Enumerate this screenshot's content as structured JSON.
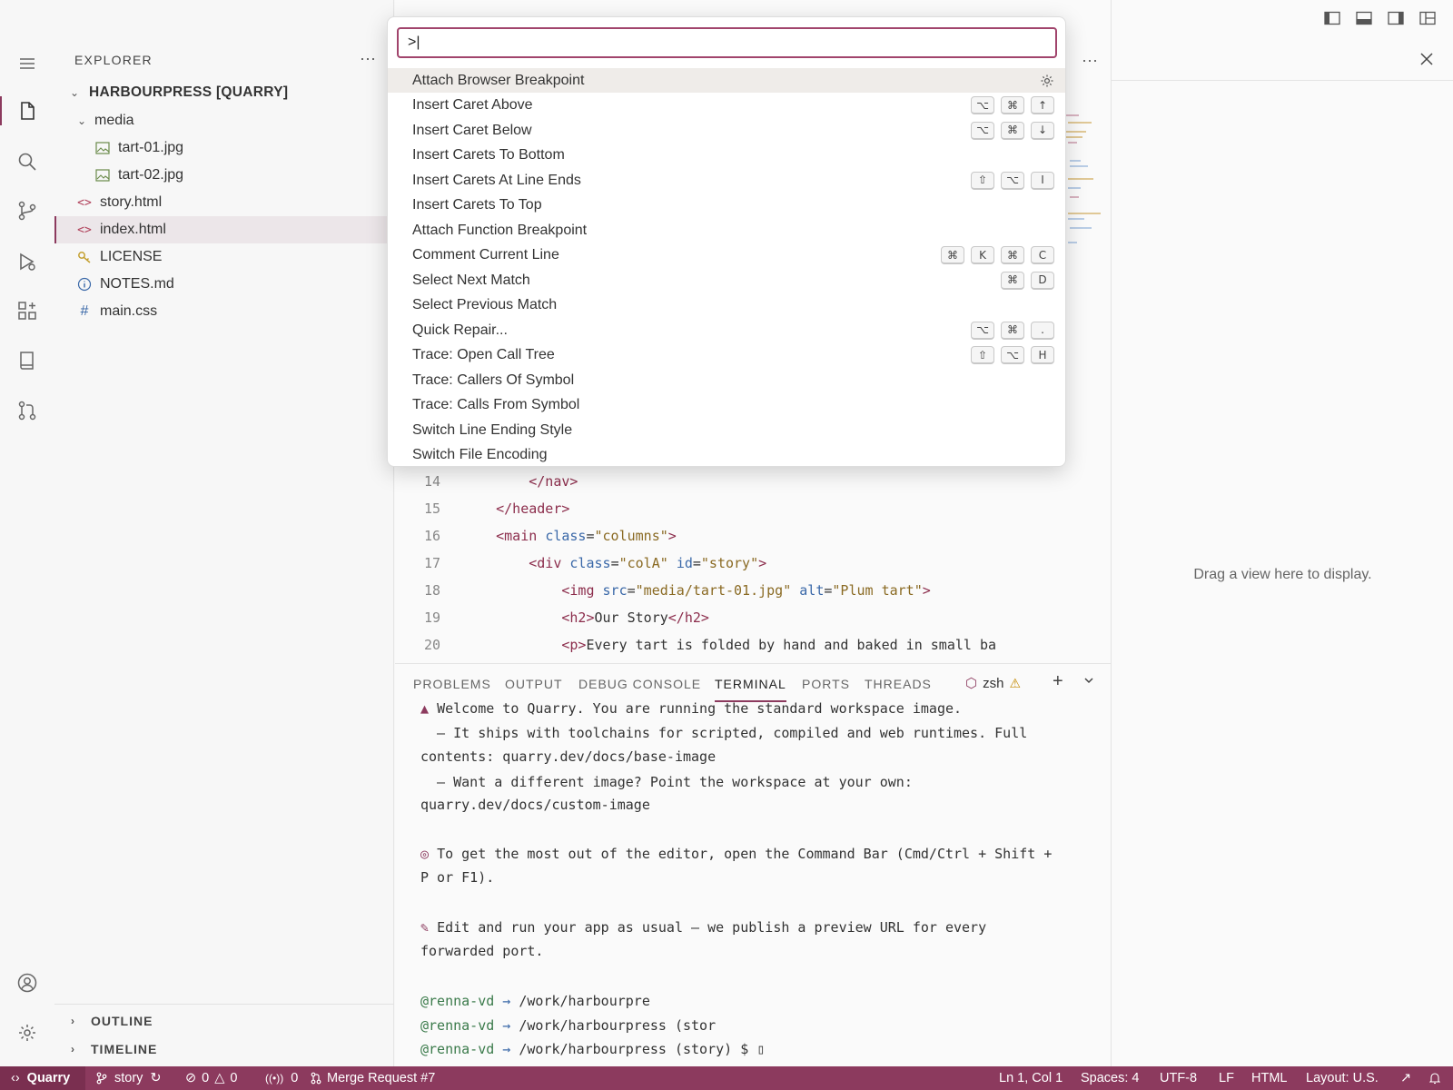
{
  "sidebar": {
    "title": "EXPLORER",
    "more": "···",
    "root": "HARBOURPRESS [QUARRY]",
    "items": [
      {
        "label": "media",
        "icon": "folder"
      },
      {
        "label": "tart-01.jpg",
        "icon": "image-icon"
      },
      {
        "label": "tart-02.jpg",
        "icon": "image-icon"
      },
      {
        "label": "story.html",
        "icon": "html-icon"
      },
      {
        "label": "index.html",
        "icon": "html-icon"
      },
      {
        "label": "LICENSE",
        "icon": "key-icon"
      },
      {
        "label": "NOTES.md",
        "icon": "info-icon"
      },
      {
        "label": "main.css",
        "icon": "hash-icon"
      }
    ],
    "outline": "OUTLINE",
    "timeline": "TIMELINE"
  },
  "palette": {
    "input_value": ">|",
    "commands": [
      {
        "label": "Attach Browser Breakpoint",
        "keys": []
      },
      {
        "label": "Insert Caret Above",
        "keys": [
          "⌥",
          "⌘",
          "↑"
        ]
      },
      {
        "label": "Insert Caret Below",
        "keys": [
          "⌥",
          "⌘",
          "↓"
        ]
      },
      {
        "label": "Insert Carets To Bottom",
        "keys": []
      },
      {
        "label": "Insert Carets At Line Ends",
        "keys": [
          "⇧",
          "⌥",
          "I"
        ]
      },
      {
        "label": "Insert Carets To Top",
        "keys": []
      },
      {
        "label": "Attach Function Breakpoint",
        "keys": []
      },
      {
        "label": "Comment Current Line",
        "keys": [
          "⌘",
          "K",
          "⌘",
          "C"
        ]
      },
      {
        "label": "Select Next Match",
        "keys": [
          "⌘",
          "D"
        ]
      },
      {
        "label": "Select Previous Match",
        "keys": []
      },
      {
        "label": "Quick Repair...",
        "keys": [
          "⌥",
          "⌘",
          "."
        ]
      },
      {
        "label": "Trace: Open Call Tree",
        "keys": [
          "⇧",
          "⌥",
          "H"
        ]
      },
      {
        "label": "Trace: Callers Of Symbol",
        "keys": []
      },
      {
        "label": "Trace: Calls From Symbol",
        "keys": []
      },
      {
        "label": "Switch Line Ending Style",
        "keys": []
      },
      {
        "label": "Switch File Encoding",
        "keys": []
      }
    ]
  },
  "editor": {
    "lines": [
      {
        "n": "14",
        "parts": [
          [
            "plain",
            "        "
          ],
          [
            "tag",
            "</nav>"
          ]
        ]
      },
      {
        "n": "15",
        "parts": [
          [
            "plain",
            "    "
          ],
          [
            "tag",
            "</header>"
          ]
        ]
      },
      {
        "n": "16",
        "parts": [
          [
            "plain",
            "    "
          ],
          [
            "tag",
            "<main "
          ],
          [
            "attr",
            "class"
          ],
          [
            "plain",
            "="
          ],
          [
            "str",
            "\"columns\""
          ],
          [
            "tag",
            ">"
          ]
        ]
      },
      {
        "n": "17",
        "parts": [
          [
            "plain",
            "        "
          ],
          [
            "tag",
            "<div "
          ],
          [
            "attr",
            "class"
          ],
          [
            "plain",
            "="
          ],
          [
            "str",
            "\"colA\""
          ],
          [
            "plain",
            " "
          ],
          [
            "attr",
            "id"
          ],
          [
            "plain",
            "="
          ],
          [
            "str",
            "\"story\""
          ],
          [
            "tag",
            ">"
          ]
        ]
      },
      {
        "n": "18",
        "parts": [
          [
            "plain",
            "            "
          ],
          [
            "tag",
            "<img "
          ],
          [
            "attr",
            "src"
          ],
          [
            "plain",
            "="
          ],
          [
            "str",
            "\"media/tart-01.jpg\""
          ],
          [
            "plain",
            " "
          ],
          [
            "attr",
            "alt"
          ],
          [
            "plain",
            "="
          ],
          [
            "str",
            "\"Plum tart\""
          ],
          [
            "tag",
            ">"
          ]
        ]
      },
      {
        "n": "19",
        "parts": [
          [
            "plain",
            "            "
          ],
          [
            "tag",
            "<h2>"
          ],
          [
            "plain",
            "Our Story"
          ],
          [
            "tag",
            "</h2>"
          ]
        ]
      },
      {
        "n": "20",
        "parts": [
          [
            "plain",
            "            "
          ],
          [
            "tag",
            "<p>"
          ],
          [
            "plain",
            "Every tart is folded by hand and baked in small ba"
          ]
        ]
      }
    ]
  },
  "right_panel": {
    "hint": "Drag a view here to display."
  },
  "panel": {
    "tabs": [
      "PROBLEMS",
      "OUTPUT",
      "DEBUG CONSOLE",
      "TERMINAL",
      "PORTS",
      "THREADS"
    ],
    "active_tab": "TERMINAL",
    "shell": "zsh",
    "terminal": {
      "welcome": "Welcome to Quarry. You are running the standard workspace image.",
      "l2": "  — It ships with toolchains for scripted, compiled and web runtimes. Full",
      "l3": "contents: quarry.dev/docs/base-image",
      "l4": "  — Want a different image? Point the workspace at your own:",
      "l5": "quarry.dev/docs/custom-image",
      "l6": "To get the most out of the editor, open the Command Bar (Cmd/Ctrl + Shift +",
      "l7": "P or F1).",
      "l8": "Edit and run your app as usual — we publish a preview URL for every",
      "l9": "forwarded port.",
      "p1_user": "@renna-vd",
      "p1_path": "/work/harbourpre",
      "p2_user": "@renna-vd",
      "p2_path": "/work/harbourpress (stor",
      "p3_user": "@renna-vd",
      "p3_path": "/work/harbourpress (story) $ "
    }
  },
  "status": {
    "remote": "Quarry",
    "branch": "story",
    "errors": "0",
    "warnings": "0",
    "ports": "0",
    "merge": "Merge Request #7",
    "position": "Ln 1, Col 1",
    "spaces": "Spaces: 4",
    "encoding": "UTF-8",
    "eol": "LF",
    "language": "HTML",
    "layout": "Layout: U.S."
  },
  "colors": {
    "accent": "#8c3a5e",
    "status_bg": "#8c3a5e",
    "focus_border": "#a1446c"
  }
}
